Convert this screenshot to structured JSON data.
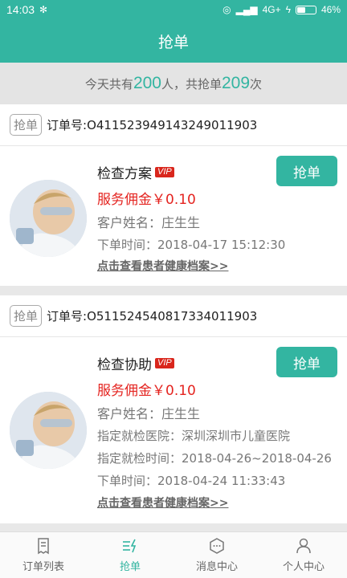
{
  "status": {
    "time": "14:03",
    "network": "4G+",
    "battery": "46%",
    "battery_level": 0.46
  },
  "header": {
    "title": "抢单"
  },
  "summary": {
    "prefix": "今天共有",
    "people": "200",
    "middle": "人，共抢单",
    "count": "209",
    "suffix": "次"
  },
  "orders": [
    {
      "tag": "抢单",
      "order_no": "订单号:O411523949143249011903",
      "title": "检查方案",
      "vip": "VIP",
      "commission": "服务佣金￥0.10",
      "customer": "客户姓名：庄生生",
      "order_time": "下单时间：2018-04-17 15:12:30",
      "link": "点击查看患者健康档案>>",
      "button": "抢单"
    },
    {
      "tag": "抢单",
      "order_no": "订单号:O511524540817334011903",
      "title": "检查协助",
      "vip": "VIP",
      "commission": "服务佣金￥0.10",
      "customer": "客户姓名：庄生生",
      "hospital": "指定就检医院：深圳深圳市儿童医院",
      "check_time": "指定就检时间：2018-04-26~2018-04-26",
      "order_time": "下单时间：2018-04-24 11:33:43",
      "link": "点击查看患者健康档案>>",
      "button": "抢单"
    }
  ],
  "tabs": [
    {
      "label": "订单列表",
      "icon": "receipt-icon"
    },
    {
      "label": "抢单",
      "icon": "grab-lightning-icon"
    },
    {
      "label": "消息中心",
      "icon": "message-icon"
    },
    {
      "label": "个人中心",
      "icon": "user-icon"
    }
  ],
  "colors": {
    "accent": "#33b5a1",
    "price": "#e4231f",
    "vip": "#d9261c"
  }
}
